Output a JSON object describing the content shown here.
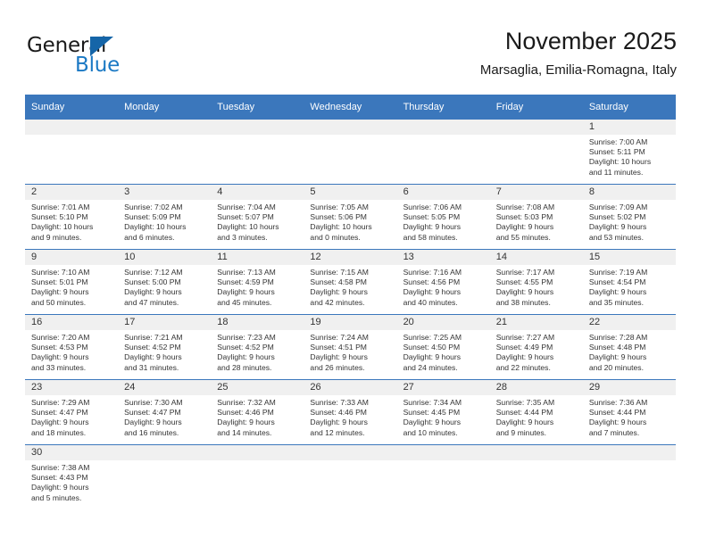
{
  "brand": {
    "name_top": "General",
    "name_bottom": "Blue",
    "accent_color": "#1b79c4",
    "triangle_color": "#1565a8"
  },
  "header": {
    "title": "November 2025",
    "subtitle": "Marsaglia, Emilia-Romagna, Italy"
  },
  "theme": {
    "header_bg": "#3b77bc",
    "header_text": "#ffffff",
    "daynum_band_bg": "#f0f0f0",
    "row_rule": "#3b77bc",
    "body_text": "#333333"
  },
  "weekdays": [
    "Sunday",
    "Monday",
    "Tuesday",
    "Wednesday",
    "Thursday",
    "Friday",
    "Saturday"
  ],
  "labels": {
    "sunrise_prefix": "Sunrise:",
    "sunset_prefix": "Sunset:",
    "daylight_prefix": "Daylight:"
  },
  "weeks": [
    [
      {
        "day": "",
        "empty": true
      },
      {
        "day": "",
        "empty": true
      },
      {
        "day": "",
        "empty": true
      },
      {
        "day": "",
        "empty": true
      },
      {
        "day": "",
        "empty": true
      },
      {
        "day": "",
        "empty": true
      },
      {
        "day": "1",
        "sunrise": "Sunrise: 7:00 AM",
        "sunset": "Sunset: 5:11 PM",
        "daylight1": "Daylight: 10 hours",
        "daylight2": "and 11 minutes."
      }
    ],
    [
      {
        "day": "2",
        "sunrise": "Sunrise: 7:01 AM",
        "sunset": "Sunset: 5:10 PM",
        "daylight1": "Daylight: 10 hours",
        "daylight2": "and 9 minutes."
      },
      {
        "day": "3",
        "sunrise": "Sunrise: 7:02 AM",
        "sunset": "Sunset: 5:09 PM",
        "daylight1": "Daylight: 10 hours",
        "daylight2": "and 6 minutes."
      },
      {
        "day": "4",
        "sunrise": "Sunrise: 7:04 AM",
        "sunset": "Sunset: 5:07 PM",
        "daylight1": "Daylight: 10 hours",
        "daylight2": "and 3 minutes."
      },
      {
        "day": "5",
        "sunrise": "Sunrise: 7:05 AM",
        "sunset": "Sunset: 5:06 PM",
        "daylight1": "Daylight: 10 hours",
        "daylight2": "and 0 minutes."
      },
      {
        "day": "6",
        "sunrise": "Sunrise: 7:06 AM",
        "sunset": "Sunset: 5:05 PM",
        "daylight1": "Daylight: 9 hours",
        "daylight2": "and 58 minutes."
      },
      {
        "day": "7",
        "sunrise": "Sunrise: 7:08 AM",
        "sunset": "Sunset: 5:03 PM",
        "daylight1": "Daylight: 9 hours",
        "daylight2": "and 55 minutes."
      },
      {
        "day": "8",
        "sunrise": "Sunrise: 7:09 AM",
        "sunset": "Sunset: 5:02 PM",
        "daylight1": "Daylight: 9 hours",
        "daylight2": "and 53 minutes."
      }
    ],
    [
      {
        "day": "9",
        "sunrise": "Sunrise: 7:10 AM",
        "sunset": "Sunset: 5:01 PM",
        "daylight1": "Daylight: 9 hours",
        "daylight2": "and 50 minutes."
      },
      {
        "day": "10",
        "sunrise": "Sunrise: 7:12 AM",
        "sunset": "Sunset: 5:00 PM",
        "daylight1": "Daylight: 9 hours",
        "daylight2": "and 47 minutes."
      },
      {
        "day": "11",
        "sunrise": "Sunrise: 7:13 AM",
        "sunset": "Sunset: 4:59 PM",
        "daylight1": "Daylight: 9 hours",
        "daylight2": "and 45 minutes."
      },
      {
        "day": "12",
        "sunrise": "Sunrise: 7:15 AM",
        "sunset": "Sunset: 4:58 PM",
        "daylight1": "Daylight: 9 hours",
        "daylight2": "and 42 minutes."
      },
      {
        "day": "13",
        "sunrise": "Sunrise: 7:16 AM",
        "sunset": "Sunset: 4:56 PM",
        "daylight1": "Daylight: 9 hours",
        "daylight2": "and 40 minutes."
      },
      {
        "day": "14",
        "sunrise": "Sunrise: 7:17 AM",
        "sunset": "Sunset: 4:55 PM",
        "daylight1": "Daylight: 9 hours",
        "daylight2": "and 38 minutes."
      },
      {
        "day": "15",
        "sunrise": "Sunrise: 7:19 AM",
        "sunset": "Sunset: 4:54 PM",
        "daylight1": "Daylight: 9 hours",
        "daylight2": "and 35 minutes."
      }
    ],
    [
      {
        "day": "16",
        "sunrise": "Sunrise: 7:20 AM",
        "sunset": "Sunset: 4:53 PM",
        "daylight1": "Daylight: 9 hours",
        "daylight2": "and 33 minutes."
      },
      {
        "day": "17",
        "sunrise": "Sunrise: 7:21 AM",
        "sunset": "Sunset: 4:52 PM",
        "daylight1": "Daylight: 9 hours",
        "daylight2": "and 31 minutes."
      },
      {
        "day": "18",
        "sunrise": "Sunrise: 7:23 AM",
        "sunset": "Sunset: 4:52 PM",
        "daylight1": "Daylight: 9 hours",
        "daylight2": "and 28 minutes."
      },
      {
        "day": "19",
        "sunrise": "Sunrise: 7:24 AM",
        "sunset": "Sunset: 4:51 PM",
        "daylight1": "Daylight: 9 hours",
        "daylight2": "and 26 minutes."
      },
      {
        "day": "20",
        "sunrise": "Sunrise: 7:25 AM",
        "sunset": "Sunset: 4:50 PM",
        "daylight1": "Daylight: 9 hours",
        "daylight2": "and 24 minutes."
      },
      {
        "day": "21",
        "sunrise": "Sunrise: 7:27 AM",
        "sunset": "Sunset: 4:49 PM",
        "daylight1": "Daylight: 9 hours",
        "daylight2": "and 22 minutes."
      },
      {
        "day": "22",
        "sunrise": "Sunrise: 7:28 AM",
        "sunset": "Sunset: 4:48 PM",
        "daylight1": "Daylight: 9 hours",
        "daylight2": "and 20 minutes."
      }
    ],
    [
      {
        "day": "23",
        "sunrise": "Sunrise: 7:29 AM",
        "sunset": "Sunset: 4:47 PM",
        "daylight1": "Daylight: 9 hours",
        "daylight2": "and 18 minutes."
      },
      {
        "day": "24",
        "sunrise": "Sunrise: 7:30 AM",
        "sunset": "Sunset: 4:47 PM",
        "daylight1": "Daylight: 9 hours",
        "daylight2": "and 16 minutes."
      },
      {
        "day": "25",
        "sunrise": "Sunrise: 7:32 AM",
        "sunset": "Sunset: 4:46 PM",
        "daylight1": "Daylight: 9 hours",
        "daylight2": "and 14 minutes."
      },
      {
        "day": "26",
        "sunrise": "Sunrise: 7:33 AM",
        "sunset": "Sunset: 4:46 PM",
        "daylight1": "Daylight: 9 hours",
        "daylight2": "and 12 minutes."
      },
      {
        "day": "27",
        "sunrise": "Sunrise: 7:34 AM",
        "sunset": "Sunset: 4:45 PM",
        "daylight1": "Daylight: 9 hours",
        "daylight2": "and 10 minutes."
      },
      {
        "day": "28",
        "sunrise": "Sunrise: 7:35 AM",
        "sunset": "Sunset: 4:44 PM",
        "daylight1": "Daylight: 9 hours",
        "daylight2": "and 9 minutes."
      },
      {
        "day": "29",
        "sunrise": "Sunrise: 7:36 AM",
        "sunset": "Sunset: 4:44 PM",
        "daylight1": "Daylight: 9 hours",
        "daylight2": "and 7 minutes."
      }
    ],
    [
      {
        "day": "30",
        "sunrise": "Sunrise: 7:38 AM",
        "sunset": "Sunset: 4:43 PM",
        "daylight1": "Daylight: 9 hours",
        "daylight2": "and 5 minutes."
      },
      {
        "day": "",
        "empty": true
      },
      {
        "day": "",
        "empty": true
      },
      {
        "day": "",
        "empty": true
      },
      {
        "day": "",
        "empty": true
      },
      {
        "day": "",
        "empty": true
      },
      {
        "day": "",
        "empty": true
      }
    ]
  ]
}
